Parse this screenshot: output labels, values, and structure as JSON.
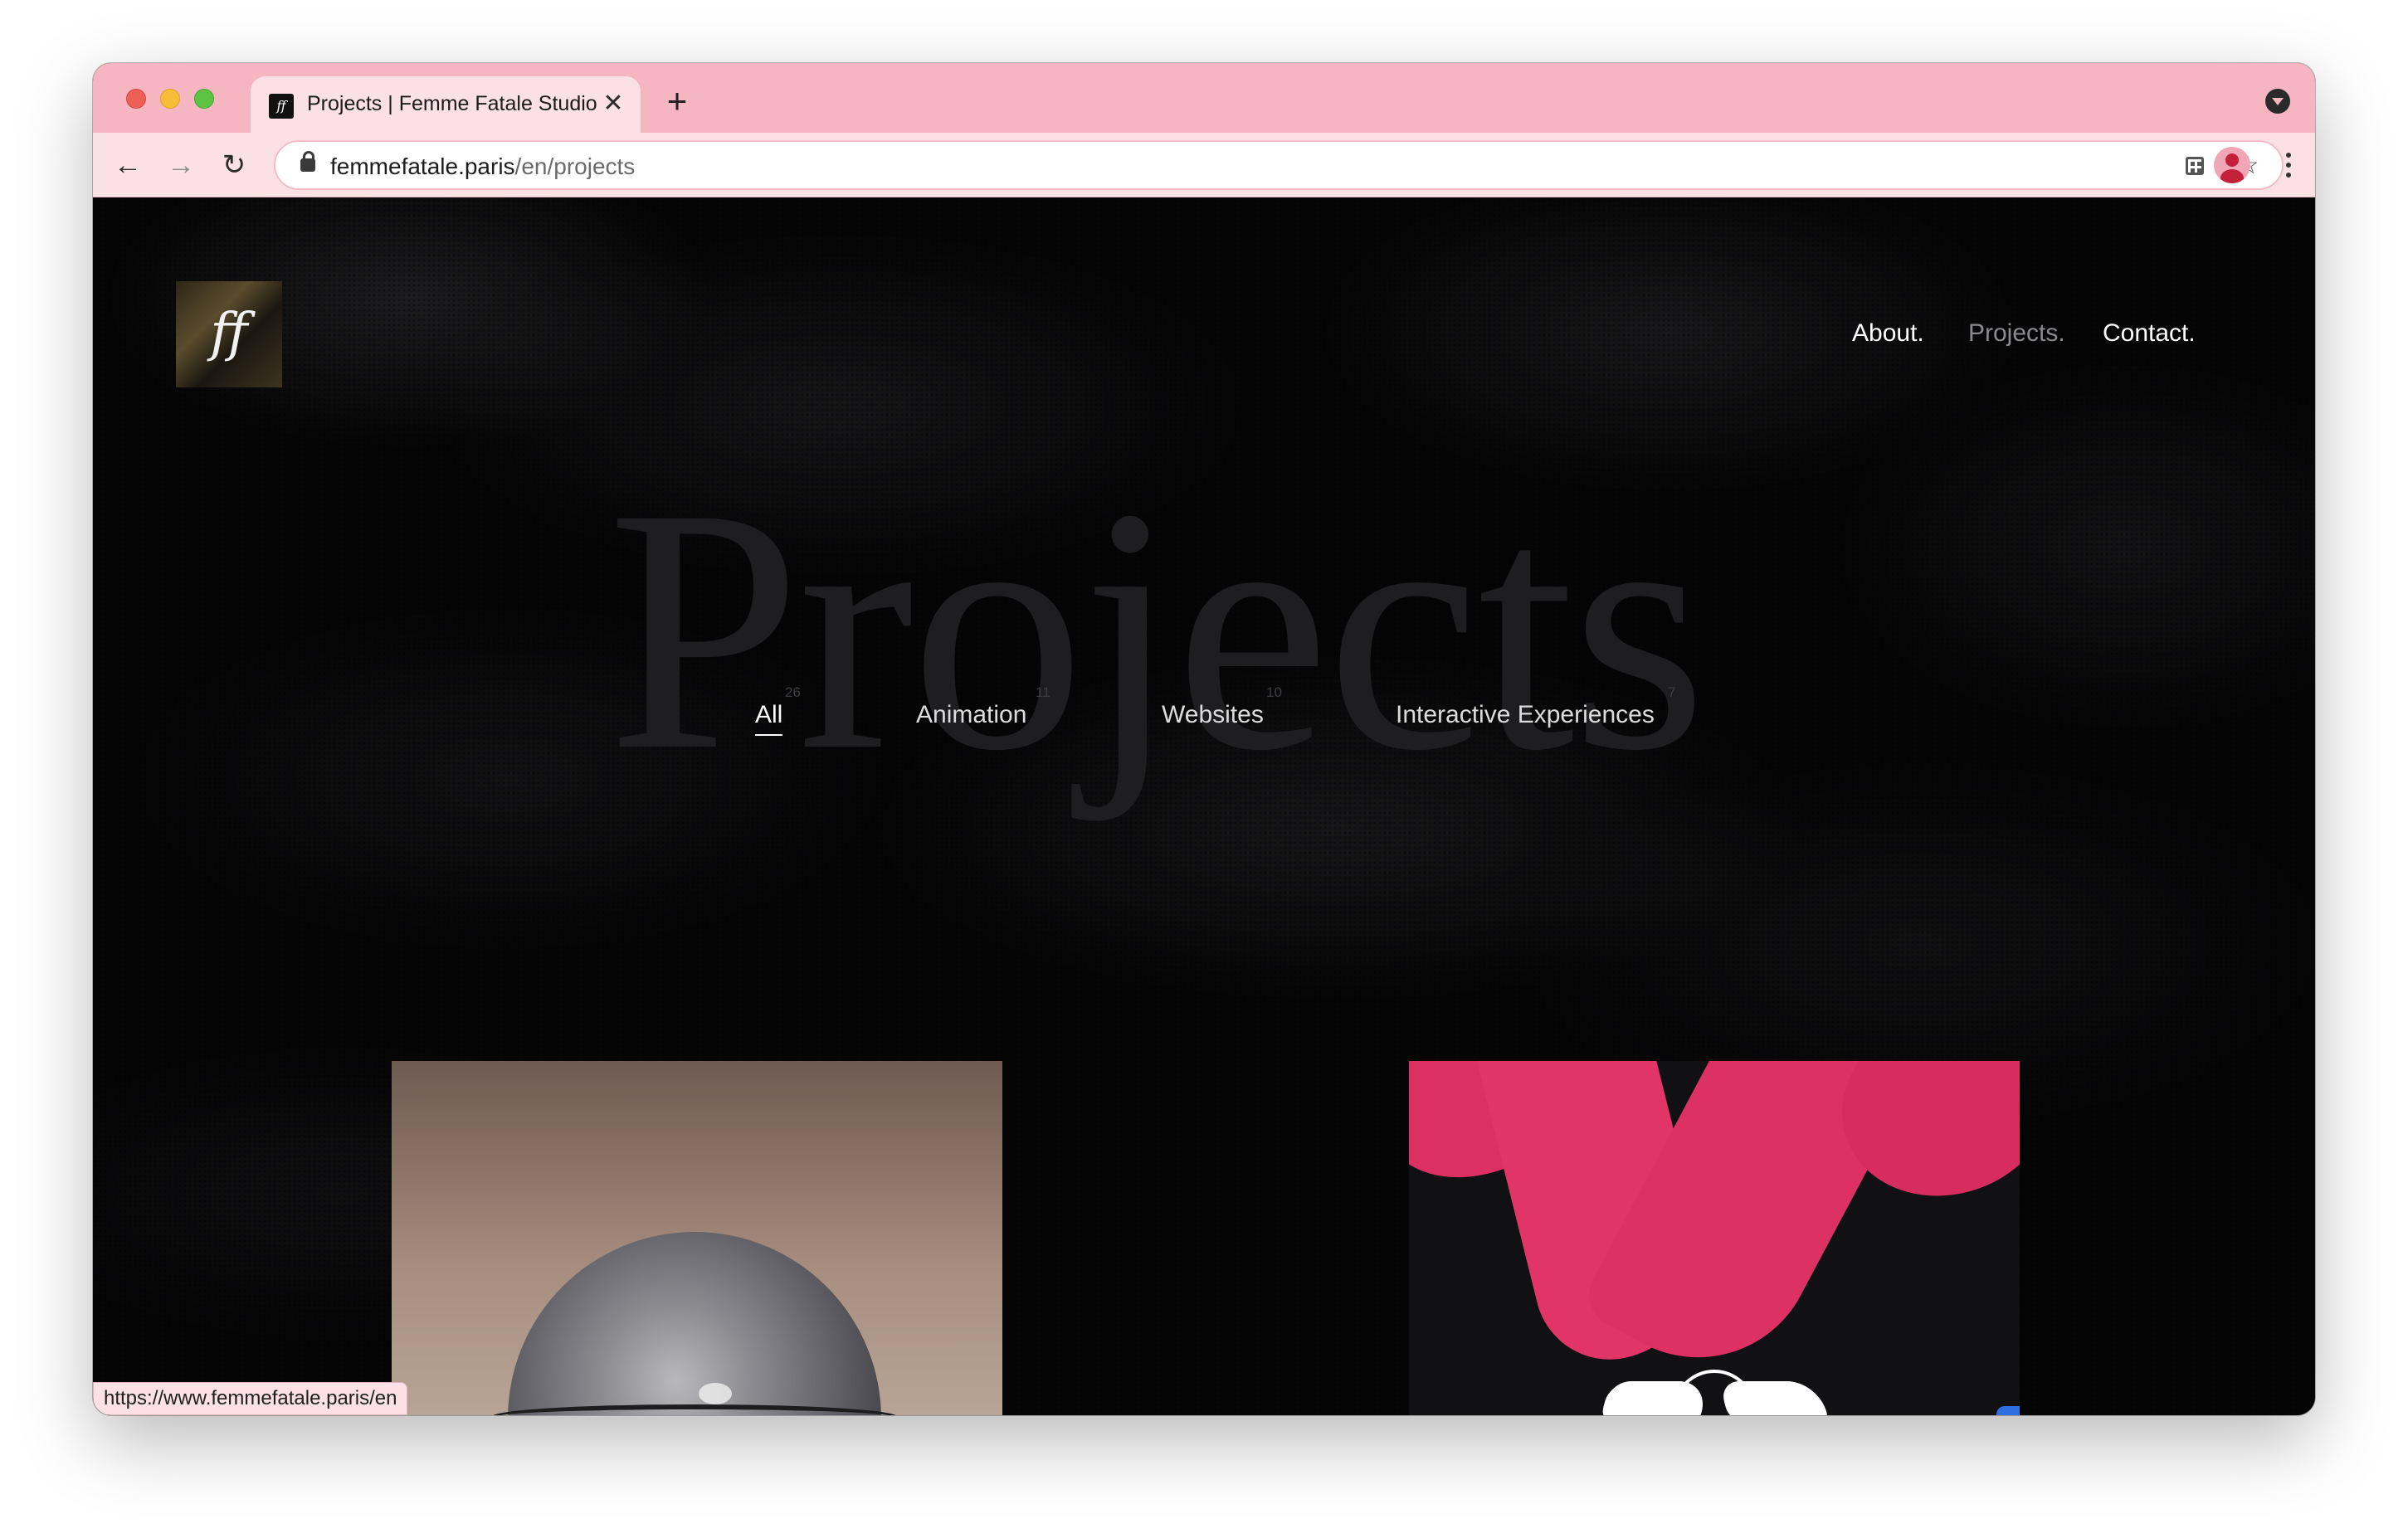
{
  "browser": {
    "tab_title": "Projects | Femme Fatale Studio",
    "tab_favicon": "ff",
    "close_glyph": "✕",
    "newtab_glyph": "+",
    "back_glyph": "←",
    "forward_glyph": "→",
    "reload_glyph": "↻",
    "star_glyph": "☆",
    "url_domain": "femmefatale.paris",
    "url_path": "/en/projects",
    "status_url": "https://www.femmefatale.paris/en"
  },
  "site": {
    "logo_text": "ff",
    "nav": {
      "about": "About.",
      "projects": "Projects.",
      "contact": "Contact."
    },
    "hero_word": "Projects",
    "filters": [
      {
        "label": "All",
        "count": "26"
      },
      {
        "label": "Animation",
        "count": "11"
      },
      {
        "label": "Websites",
        "count": "10"
      },
      {
        "label": "Interactive Experiences",
        "count": "7"
      }
    ],
    "active_filter": "All"
  },
  "colors": {
    "tabstrip": "#f5b6c1",
    "toolbar": "#fbe1e6",
    "page_bg": "#050506",
    "accent_pink": "#e03566",
    "nav_inactive": "#8a8a8e"
  },
  "icons": {
    "lock": "lock-icon",
    "qr": "qr-code-icon",
    "star": "bookmark-star-icon",
    "profile": "profile-avatar-icon",
    "menu": "kebab-menu-icon",
    "tab_search": "tab-search-icon"
  }
}
